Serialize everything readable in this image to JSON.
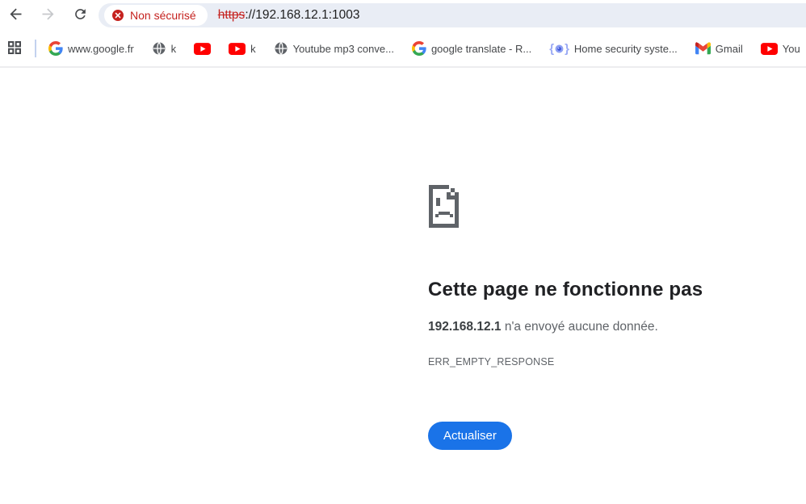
{
  "colors": {
    "accent_blue": "#1a73e8",
    "danger_red": "#c5221f",
    "youtube_red": "#ff0000",
    "text_dark": "#202124",
    "text_gray": "#5f6368",
    "omnibox_bg": "#e9edf5"
  },
  "toolbar": {
    "icons": [
      "back-icon",
      "forward-icon",
      "reload-icon"
    ],
    "security_chip_label": "Non sécurisé",
    "url_scheme": "https",
    "url_rest": "://192.168.12.1:1003"
  },
  "bookmarks_bar": {
    "items": [
      {
        "icon": "google-g",
        "label": "www.google.fr"
      },
      {
        "icon": "globe",
        "label": "k"
      },
      {
        "icon": "youtube",
        "label": ""
      },
      {
        "icon": "youtube",
        "label": "k"
      },
      {
        "icon": "globe",
        "label": "Youtube mp3 conve..."
      },
      {
        "icon": "google-g",
        "label": "google translate - R..."
      },
      {
        "icon": "security-camera",
        "label": "Home security syste..."
      },
      {
        "icon": "gmail",
        "label": "Gmail"
      },
      {
        "icon": "youtube",
        "label": "You"
      }
    ]
  },
  "error_page": {
    "title": "Cette page ne fonctionne pas",
    "message_host": "192.168.12.1",
    "message_rest": " n'a envoyé aucune donnée.",
    "error_code": "ERR_EMPTY_RESPONSE",
    "reload_button_label": "Actualiser"
  }
}
